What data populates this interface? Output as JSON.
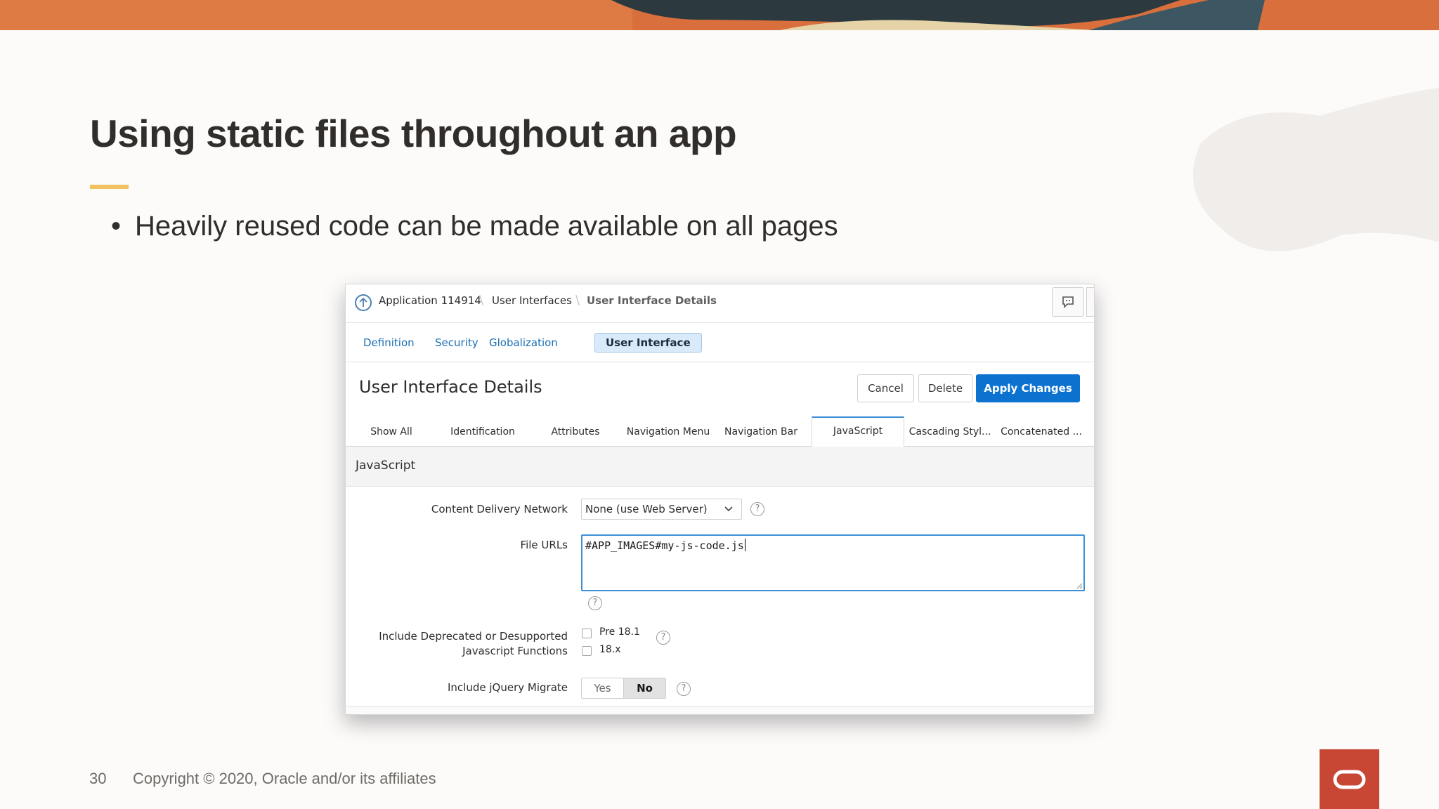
{
  "slide": {
    "title": "Using static files throughout an app",
    "bullet": "Heavily reused code can be made available on all pages",
    "page_number": "30",
    "copyright": "Copyright © 2020, Oracle and/or its affiliates",
    "accent_color": "#f1c162",
    "logo_color": "#c74634",
    "logo_icon": "oracle-logo-icon"
  },
  "apex": {
    "breadcrumb": {
      "items": [
        "Application 114914",
        "User Interfaces",
        "User Interface Details"
      ],
      "separator": "\\",
      "up_icon": "arrow-up-circle-icon",
      "feedback_icon": "chat-bubble-icon"
    },
    "top_tabs": [
      {
        "label": "Definition",
        "active": false
      },
      {
        "label": "Security",
        "active": false
      },
      {
        "label": "Globalization",
        "active": false
      },
      {
        "label": "User Interface",
        "active": true
      }
    ],
    "region": {
      "title": "User Interface Details",
      "buttons": {
        "cancel": "Cancel",
        "delete": "Delete",
        "apply": "Apply Changes"
      },
      "primary_color": "#0b72d0"
    },
    "sub_tabs": [
      {
        "label": "Show All",
        "active": false
      },
      {
        "label": "Identification",
        "active": false
      },
      {
        "label": "Attributes",
        "active": false
      },
      {
        "label": "Navigation Menu",
        "active": false
      },
      {
        "label": "Navigation Bar",
        "active": false
      },
      {
        "label": "JavaScript",
        "active": true
      },
      {
        "label": "Cascading Styl...",
        "active": false
      },
      {
        "label": "Concatenated ...",
        "active": false
      }
    ],
    "javascript": {
      "section_title": "JavaScript",
      "cdn": {
        "label": "Content Delivery Network",
        "value": "None (use Web Server)"
      },
      "file_urls": {
        "label": "File URLs",
        "value": "#APP_IMAGES#my-js-code.js"
      },
      "deprecated": {
        "label_line1": "Include Deprecated or Desupported",
        "label_line2": "Javascript Functions",
        "options": [
          {
            "label": "Pre 18.1",
            "checked": false
          },
          {
            "label": "18.x",
            "checked": false
          }
        ]
      },
      "jquery_migrate": {
        "label": "Include jQuery Migrate",
        "yes": "Yes",
        "no": "No",
        "selected": "No"
      },
      "help_glyph": "?"
    }
  }
}
